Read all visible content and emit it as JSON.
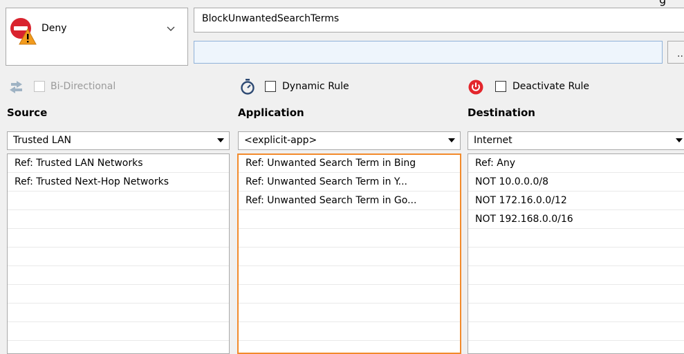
{
  "action": {
    "label": "Deny",
    "icon": "deny-warning-icon"
  },
  "rule": {
    "name": "BlockUnwantedSearchTerms",
    "description": "",
    "more_label": "..."
  },
  "top_hint": "g",
  "options": {
    "bidirectional": {
      "label": "Bi-Directional",
      "checked": false,
      "enabled": false
    },
    "dynamic": {
      "label": "Dynamic Rule",
      "checked": false,
      "enabled": true
    },
    "deactivate": {
      "label": "Deactivate Rule",
      "checked": false,
      "enabled": true
    }
  },
  "source": {
    "header": "Source",
    "selected": "Trusted  LAN",
    "items": [
      "Ref: Trusted LAN Networks",
      "Ref: Trusted Next-Hop Networks"
    ]
  },
  "application": {
    "header": "Application",
    "selected": "<explicit-app>",
    "items": [
      "Ref: Unwanted Search Term in Bing",
      "Ref: Unwanted Search Term in  Y...",
      "Ref: Unwanted Search Term in Go..."
    ]
  },
  "destination": {
    "header": "Destination",
    "selected": "Internet",
    "items": [
      "Ref: Any",
      "NOT 10.0.0.0/8",
      "NOT 172.16.0.0/12",
      "NOT 192.168.0.0/16"
    ]
  },
  "colors": {
    "selection_border": "#f28a2b",
    "deny_red": "#d9232e",
    "warning_orange": "#f29b1d",
    "power_red": "#e3262c"
  }
}
